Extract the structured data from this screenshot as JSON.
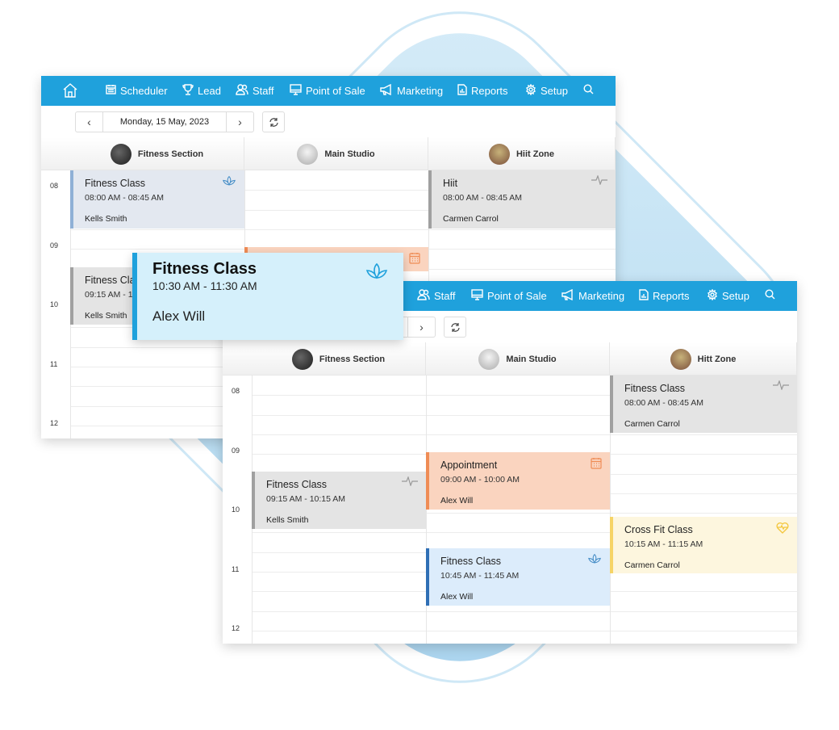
{
  "nav": {
    "items": [
      {
        "label": "",
        "icon": "home-icon"
      },
      {
        "label": "Scheduler",
        "icon": "calendar-icon"
      },
      {
        "label": "Lead",
        "icon": "trophy-icon"
      },
      {
        "label": "Staff",
        "icon": "users-icon"
      },
      {
        "label": "Point of Sale",
        "icon": "monitor-icon"
      },
      {
        "label": "Marketing",
        "icon": "megaphone-icon"
      },
      {
        "label": "Reports",
        "icon": "report-icon"
      },
      {
        "label": "Setup",
        "icon": "gear-icon"
      },
      {
        "label": "",
        "icon": "search-icon"
      }
    ],
    "color": "#1fa1dc"
  },
  "windows": [
    {
      "date": "Monday, 15 May, 2023",
      "columns": [
        "Fitness Section",
        "Main Studio",
        "Hiit Zone"
      ],
      "hours": [
        "08",
        "09",
        "10",
        "11",
        "12"
      ],
      "events": [
        {
          "title": "Fitness Class",
          "time": "08:00 AM - 08:45 AM",
          "who": "Kells Smith",
          "kind": "lotus"
        },
        {
          "title": "Hiit",
          "time": "08:00 AM - 08:45 AM",
          "who": "Carmen Carrol",
          "kind": "pulse"
        },
        {
          "title": "",
          "time": "",
          "who": "",
          "kind": "calendar"
        },
        {
          "title": "Fitness Class",
          "time": "09:15 AM - 10:15 AM",
          "who": "Kells Smith",
          "kind": "pulse"
        }
      ]
    },
    {
      "date": "",
      "columns": [
        "Fitness Section",
        "Main Studio",
        "Hitt Zone"
      ],
      "hours": [
        "08",
        "09",
        "10",
        "11",
        "12"
      ],
      "events": [
        {
          "title": "Fitness Class",
          "time": "08:00 AM - 08:45 AM",
          "who": "Carmen Carrol",
          "kind": "pulse"
        },
        {
          "title": "Appointment",
          "time": "09:00 AM - 10:00 AM",
          "who": "Alex Will",
          "kind": "calendar"
        },
        {
          "title": "Fitness Class",
          "time": "09:15 AM - 10:15 AM",
          "who": "Kells Smith",
          "kind": "pulse"
        },
        {
          "title": "Cross Fit Class",
          "time": "10:15 AM - 11:15 AM",
          "who": "Carmen Carrol",
          "kind": "heart"
        },
        {
          "title": "Fitness Class",
          "time": "10:45 AM - 11:45 AM",
          "who": "Alex Will",
          "kind": "lotus"
        }
      ]
    }
  ],
  "popup": {
    "title": "Fitness Class",
    "time": "10:30 AM - 11:30 AM",
    "who": "Alex Will",
    "icon": "lotus-icon"
  },
  "colors": {
    "lotus": "#e3e8f0",
    "pulse": "#e4e4e4",
    "calendar": "#fad4bf",
    "heart": "#fdf6de",
    "blue_event": "#dcecfb"
  }
}
